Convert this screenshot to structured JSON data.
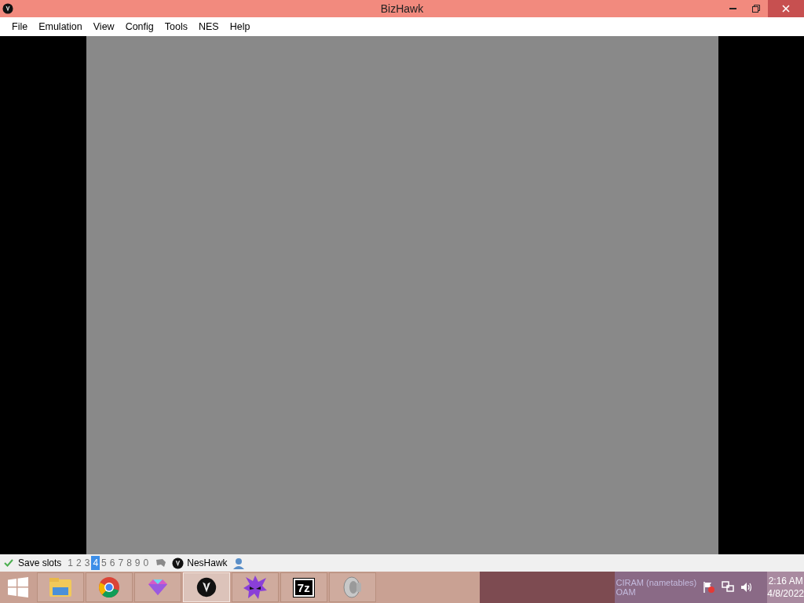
{
  "window": {
    "title": "BizHawk"
  },
  "menu": [
    "File",
    "Emulation",
    "View",
    "Config",
    "Tools",
    "NES",
    "Help"
  ],
  "status_bar": {
    "label": "Save slots",
    "slots": [
      {
        "label": "1",
        "selected": false
      },
      {
        "label": "2",
        "selected": false
      },
      {
        "label": "3",
        "selected": false
      },
      {
        "label": "4",
        "selected": true
      },
      {
        "label": "5",
        "selected": false
      },
      {
        "label": "6",
        "selected": false
      },
      {
        "label": "7",
        "selected": false
      },
      {
        "label": "8",
        "selected": false
      },
      {
        "label": "9",
        "selected": false
      },
      {
        "label": "0",
        "selected": false
      }
    ],
    "core": "NesHawk"
  },
  "taskbar": {
    "apps": [
      {
        "kind": "folder",
        "active": false
      },
      {
        "kind": "chrome",
        "active": false
      },
      {
        "kind": "gem",
        "active": false
      },
      {
        "kind": "hawk",
        "active": true
      },
      {
        "kind": "purple",
        "active": false
      },
      {
        "kind": "sevenzip",
        "label": "7z",
        "active": false
      },
      {
        "kind": "speaker",
        "active": false
      }
    ],
    "ghost_text": [
      "CIRAM (nametables)",
      "OAM"
    ],
    "time": "2:16 AM",
    "date": "4/8/2022"
  }
}
